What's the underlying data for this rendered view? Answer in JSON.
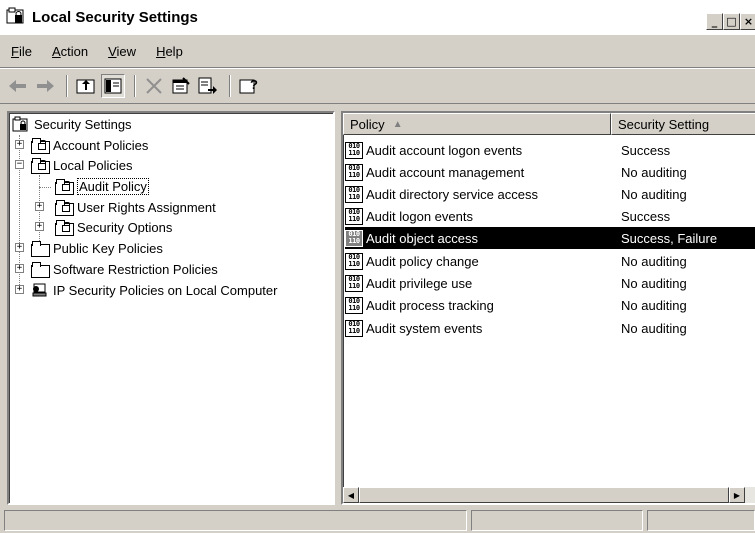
{
  "window": {
    "title": "Local Security Settings",
    "buttons": [
      "_",
      "□",
      "×"
    ]
  },
  "menu": [
    {
      "label": "File"
    },
    {
      "label": "Action"
    },
    {
      "label": "View"
    },
    {
      "label": "Help"
    }
  ],
  "toolbar": {
    "icons": [
      "back-arrow-icon",
      "forward-arrow-icon",
      "up-folder-icon",
      "show-hide-tree-icon",
      "delete-icon",
      "properties-icon",
      "export-list-icon",
      "help-icon"
    ]
  },
  "tree": {
    "root": "Security Settings",
    "items": [
      {
        "label": "Account Policies"
      },
      {
        "label": "Local Policies"
      },
      {
        "label": "Audit Policy"
      },
      {
        "label": "User Rights Assignment"
      },
      {
        "label": "Security Options"
      },
      {
        "label": "Public Key Policies"
      },
      {
        "label": "Software Restriction Policies"
      },
      {
        "label": "IP Security Policies on Local Computer"
      }
    ]
  },
  "list": {
    "columns": [
      "Policy",
      "Security Setting"
    ],
    "sort_indicator": "▲",
    "rows": [
      {
        "policy": "Audit account logon events",
        "setting": "Success"
      },
      {
        "policy": "Audit account management",
        "setting": "No auditing"
      },
      {
        "policy": "Audit directory service access",
        "setting": "No auditing"
      },
      {
        "policy": "Audit logon events",
        "setting": "Success"
      },
      {
        "policy": "Audit object access",
        "setting": "Success, Failure"
      },
      {
        "policy": "Audit policy change",
        "setting": "No auditing"
      },
      {
        "policy": "Audit privilege use",
        "setting": "No auditing"
      },
      {
        "policy": "Audit process tracking",
        "setting": "No auditing"
      },
      {
        "policy": "Audit system events",
        "setting": "No auditing"
      }
    ],
    "selected_row": "Audit object access"
  },
  "colors": {
    "chrome": "#d4d0c8",
    "selection": "#000000"
  }
}
